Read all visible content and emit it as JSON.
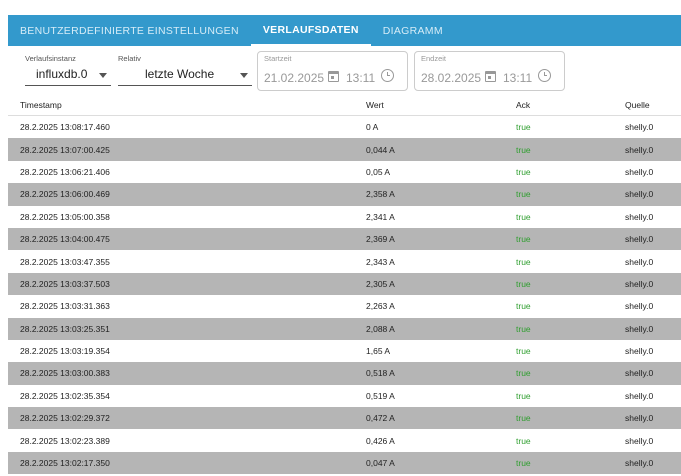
{
  "tabs": [
    {
      "label": "BENUTZERDEFINIERTE EINSTELLUNGEN",
      "active": false
    },
    {
      "label": "VERLAUFSDATEN",
      "active": true
    },
    {
      "label": "DIAGRAMM",
      "active": false
    }
  ],
  "filters": {
    "instance": {
      "label": "Verlaufsinstanz",
      "value": "influxdb.0"
    },
    "relative": {
      "label": "Relativ",
      "value": "letzte Woche"
    },
    "start": {
      "label": "Startzeit",
      "date": "21.02.2025",
      "time": "13:11"
    },
    "end": {
      "label": "Endzeit",
      "date": "28.02.2025",
      "time": "13:11"
    }
  },
  "table": {
    "headers": {
      "timestamp": "Timestamp",
      "value": "Wert",
      "ack": "Ack",
      "source": "Quelle"
    },
    "rows": [
      {
        "timestamp": "28.2.2025 13:08:17.460",
        "value": "0 A",
        "ack": "true",
        "source": "shelly.0"
      },
      {
        "timestamp": "28.2.2025 13:07:00.425",
        "value": "0,044 A",
        "ack": "true",
        "source": "shelly.0"
      },
      {
        "timestamp": "28.2.2025 13:06:21.406",
        "value": "0,05 A",
        "ack": "true",
        "source": "shelly.0"
      },
      {
        "timestamp": "28.2.2025 13:06:00.469",
        "value": "2,358 A",
        "ack": "true",
        "source": "shelly.0"
      },
      {
        "timestamp": "28.2.2025 13:05:00.358",
        "value": "2,341 A",
        "ack": "true",
        "source": "shelly.0"
      },
      {
        "timestamp": "28.2.2025 13:04:00.475",
        "value": "2,369 A",
        "ack": "true",
        "source": "shelly.0"
      },
      {
        "timestamp": "28.2.2025 13:03:47.355",
        "value": "2,343 A",
        "ack": "true",
        "source": "shelly.0"
      },
      {
        "timestamp": "28.2.2025 13:03:37.503",
        "value": "2,305 A",
        "ack": "true",
        "source": "shelly.0"
      },
      {
        "timestamp": "28.2.2025 13:03:31.363",
        "value": "2,263 A",
        "ack": "true",
        "source": "shelly.0"
      },
      {
        "timestamp": "28.2.2025 13:03:25.351",
        "value": "2,088 A",
        "ack": "true",
        "source": "shelly.0"
      },
      {
        "timestamp": "28.2.2025 13:03:19.354",
        "value": "1,65 A",
        "ack": "true",
        "source": "shelly.0"
      },
      {
        "timestamp": "28.2.2025 13:03:00.383",
        "value": "0,518 A",
        "ack": "true",
        "source": "shelly.0"
      },
      {
        "timestamp": "28.2.2025 13:02:35.354",
        "value": "0,519 A",
        "ack": "true",
        "source": "shelly.0"
      },
      {
        "timestamp": "28.2.2025 13:02:29.372",
        "value": "0,472 A",
        "ack": "true",
        "source": "shelly.0"
      },
      {
        "timestamp": "28.2.2025 13:02:23.389",
        "value": "0,426 A",
        "ack": "true",
        "source": "shelly.0"
      },
      {
        "timestamp": "28.2.2025 13:02:17.350",
        "value": "0,047 A",
        "ack": "true",
        "source": "shelly.0"
      }
    ]
  },
  "colors": {
    "tabbar": "#3399cc",
    "stripe": "#b5b5b5",
    "ack_true": "#2e9e2e"
  }
}
